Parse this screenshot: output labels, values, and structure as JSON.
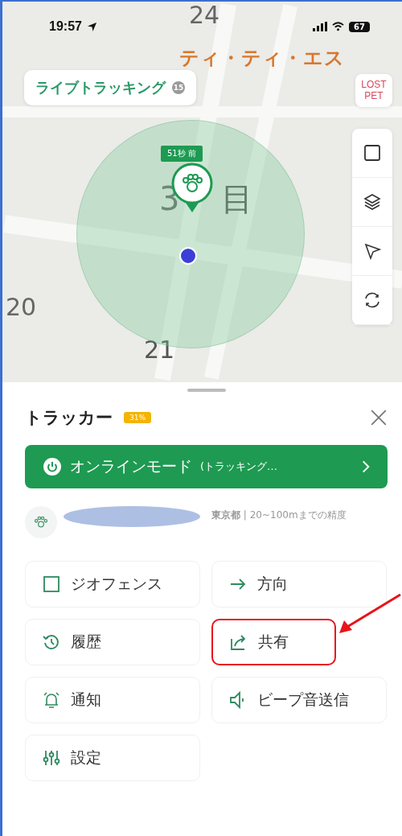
{
  "status_bar": {
    "time": "19:57",
    "battery": "67"
  },
  "map": {
    "labels": [
      {
        "text": "24"
      },
      {
        "text": "ティ・ティ・エス"
      },
      {
        "text": "3"
      },
      {
        "text": "目"
      },
      {
        "text": "20"
      },
      {
        "text": "21"
      }
    ]
  },
  "live_tracking": {
    "label": "ライブトラッキング",
    "badge": "15"
  },
  "lost_pet": {
    "label": "LOST PET"
  },
  "pet_marker": {
    "last_update": "51秒 前"
  },
  "tracker": {
    "title": "トラッカー",
    "battery": "31%"
  },
  "online_mode": {
    "label": "オンラインモード",
    "detail": "(トラッキング…"
  },
  "location": {
    "text": "**東京都** | 20~100mまでの精度"
  },
  "actions": [
    {
      "label": "ジオフェンス",
      "kind": "geofence",
      "highlighted": false
    },
    {
      "label": "方向",
      "kind": "direction",
      "highlighted": false
    },
    {
      "label": "履歴",
      "kind": "history",
      "highlighted": false
    },
    {
      "label": "共有",
      "kind": "share",
      "highlighted": true
    },
    {
      "label": "通知",
      "kind": "alarm",
      "highlighted": false
    },
    {
      "label": "ビープ音送信",
      "kind": "beep",
      "highlighted": false
    },
    {
      "label": "設定",
      "kind": "settings",
      "highlighted": false
    }
  ]
}
